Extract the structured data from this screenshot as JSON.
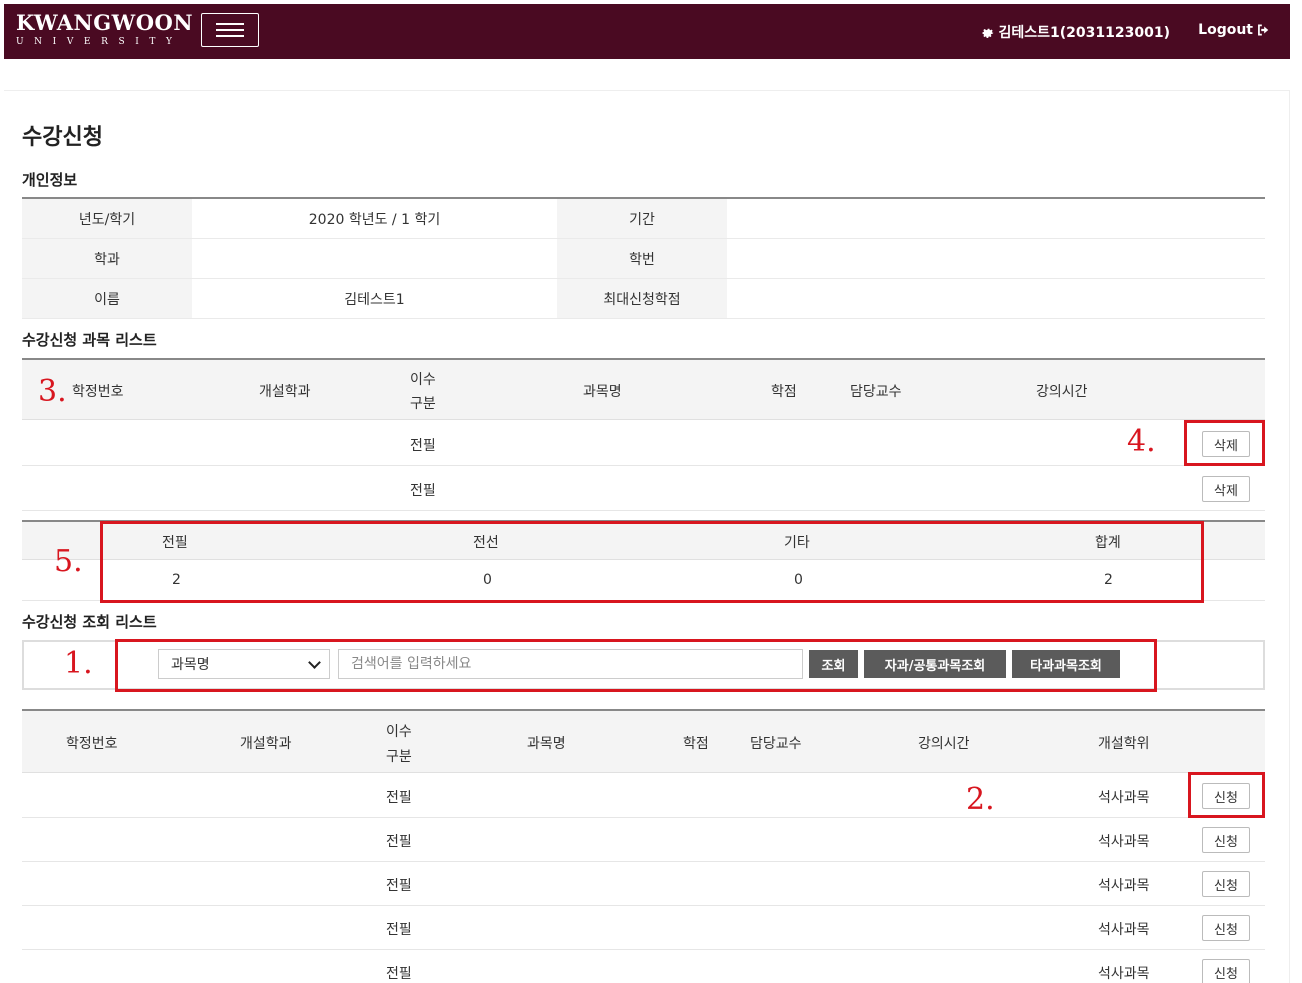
{
  "header": {
    "logo_main": "KWANGWOON",
    "logo_sub": "UNIVERSITY",
    "user_label": "김테스트1(2031123001)",
    "logout_label": "Logout"
  },
  "page": {
    "title": "수강신청"
  },
  "personal_info": {
    "section_title": "개인정보",
    "rows": [
      {
        "label1": "년도/학기",
        "value1": "2020 학년도 / 1 학기",
        "label2": "기간",
        "value2": ""
      },
      {
        "label1": "학과",
        "value1": "",
        "label2": "학번",
        "value2": ""
      },
      {
        "label1": "이름",
        "value1": "김테스트1",
        "label2": "최대신청학점",
        "value2": ""
      }
    ]
  },
  "registered": {
    "section_title": "수강신청 과목 리스트",
    "headers": [
      "학정번호",
      "개설학과",
      "이수",
      "구분",
      "과목명",
      "학점",
      "담당교수",
      "강의시간"
    ],
    "rows": [
      {
        "type": "전필",
        "action": "삭제"
      },
      {
        "type": "전필",
        "action": "삭제"
      }
    ]
  },
  "summary": {
    "headers": [
      "전필",
      "전선",
      "기타",
      "합계"
    ],
    "values": [
      "2",
      "0",
      "0",
      "2"
    ]
  },
  "search": {
    "section_title": "수강신청 조회 리스트",
    "select_value": "과목명",
    "placeholder": "검색어를 입력하세요",
    "btn_search": "조회",
    "btn_common": "자과/공통과목조회",
    "btn_other": "타과과목조회"
  },
  "results": {
    "headers": [
      "학정번호",
      "개설학과",
      "이수",
      "구분",
      "과목명",
      "학점",
      "담당교수",
      "강의시간",
      "개설학위"
    ],
    "rows": [
      {
        "type": "전필",
        "degree": "석사과목",
        "action": "신청"
      },
      {
        "type": "전필",
        "degree": "석사과목",
        "action": "신청"
      },
      {
        "type": "전필",
        "degree": "석사과목",
        "action": "신청"
      },
      {
        "type": "전필",
        "degree": "석사과목",
        "action": "신청"
      },
      {
        "type": "전필",
        "degree": "석사과목",
        "action": "신청"
      }
    ]
  },
  "annotations": {
    "n1": "1.",
    "n2": "2.",
    "n3": "3.",
    "n4": "4.",
    "n5": "5.",
    "color": "#d8161f"
  }
}
